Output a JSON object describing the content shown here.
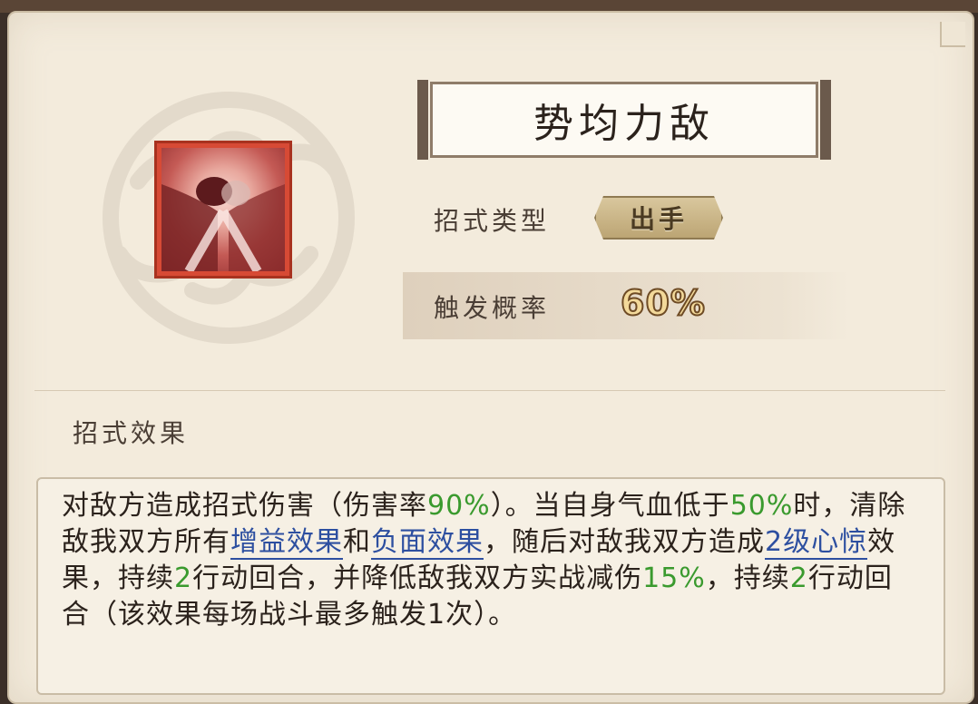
{
  "skill": {
    "name": "势均力敌",
    "type_label": "招式类型",
    "type_value": "出手",
    "prob_label": "触发概率",
    "prob_value": "60%",
    "icon": "clashing-fists-icon"
  },
  "effect": {
    "title": "招式效果",
    "segments": [
      {
        "text": "对敌方造成招式伤害（伤害率",
        "style": "normal"
      },
      {
        "text": "90%",
        "style": "green"
      },
      {
        "text": "）。当自身气血低于",
        "style": "normal"
      },
      {
        "text": "50%",
        "style": "green"
      },
      {
        "text": "时，清除敌我双方所有",
        "style": "normal"
      },
      {
        "text": "增益效果",
        "style": "link"
      },
      {
        "text": "和",
        "style": "normal"
      },
      {
        "text": "负面效果",
        "style": "link"
      },
      {
        "text": "，随后对敌我双方造成",
        "style": "normal"
      },
      {
        "text": "2级心惊",
        "style": "link"
      },
      {
        "text": "效果，持续",
        "style": "normal"
      },
      {
        "text": "2",
        "style": "green"
      },
      {
        "text": "行动回合，并降低敌我双方实战减伤",
        "style": "normal"
      },
      {
        "text": "15%",
        "style": "green"
      },
      {
        "text": "，持续",
        "style": "normal"
      },
      {
        "text": "2",
        "style": "green"
      },
      {
        "text": "行动回合（该效果每场战斗最多触发1次）。",
        "style": "normal"
      }
    ]
  },
  "colors": {
    "highlight_green": "#3a9a2e",
    "link_blue": "#2d4fa0",
    "icon_frame": "#d74a35"
  }
}
